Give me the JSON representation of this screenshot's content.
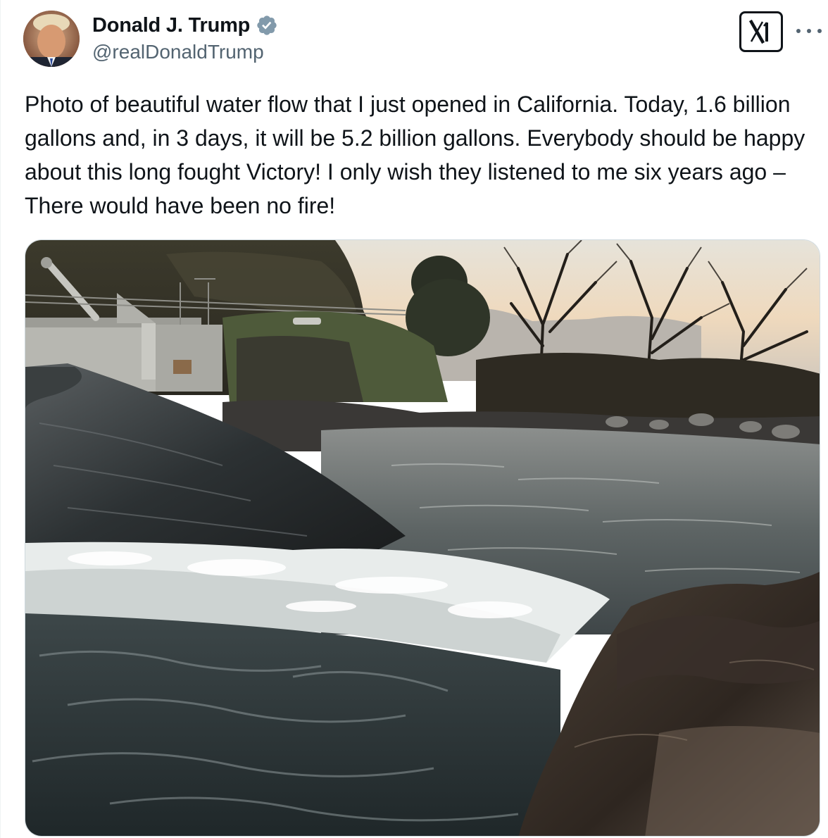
{
  "author": {
    "display_name": "Donald J. Trump",
    "handle": "@realDonaldTrump",
    "verified": true,
    "verified_color": "#829aab"
  },
  "post": {
    "text": "Photo of beautiful water flow that I just opened in California. Today, 1.6 billion gallons and, in 3 days, it will be 5.2 billion gallons. Everybody should be happy about this long fought Victory! I only wish they listened to me six years ago – There would have been no fire!"
  },
  "media": {
    "scene": "river-rapids-photo"
  },
  "icons": {
    "verified": "verified-badge-icon",
    "brand": "x-logo-icon",
    "more": "more-options-icon"
  },
  "colors": {
    "text_primary": "#0f1419",
    "text_secondary": "#536471",
    "border": "#cfd9de"
  }
}
